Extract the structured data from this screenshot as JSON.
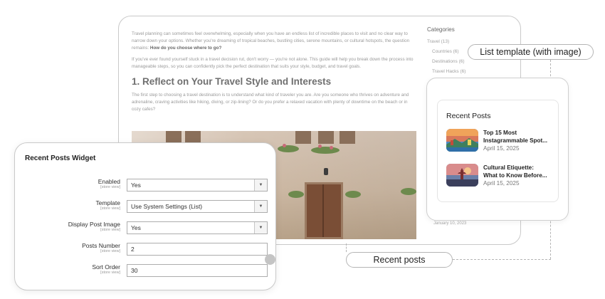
{
  "article": {
    "intro_text": "Travel planning can sometimes feel overwhelming, especially when you have an endless list of incredible places to visit and no clear way to narrow down your options. Whether you're dreaming of tropical beaches, bustling cities, serene mountains, or cultural hotspots, the question remains:",
    "intro_bold": "How do you choose where to go?",
    "para2": "If you've ever found yourself stuck in a travel decision rut, don't worry — you're not alone. This guide will help you break down the process into manageable steps, so you can confidently pick the perfect destination that suits your style, budget, and travel goals.",
    "heading": "1. Reflect on Your Travel Style and Interests",
    "para3": "The first step to choosing a travel destination is to understand what kind of traveler you are. Are you someone who thrives on adventure and adrenaline, craving activities like hiking, diving, or zip-lining? Or do you prefer a relaxed vacation with plenty of downtime on the beach or in cozy cafes?"
  },
  "sidebar": {
    "heading": "Categories",
    "items": [
      {
        "label": "Travel (13)",
        "indent": false
      },
      {
        "label": "Countries (6)",
        "indent": true
      },
      {
        "label": "Destinations (6)",
        "indent": true
      },
      {
        "label": "Travel Hacks (6)",
        "indent": true
      }
    ],
    "date": "January 10, 2023"
  },
  "labels": {
    "list_template": "List template (with image)",
    "recent_posts": "Recent posts"
  },
  "recent_posts": {
    "title": "Recent Posts",
    "items": [
      {
        "title_line1": "Top 15 Most",
        "title_line2": "Instagrammable Spot...",
        "date": "April 15, 2025"
      },
      {
        "title_line1": "Cultural Etiquette:",
        "title_line2": "What to Know Before...",
        "date": "April 15, 2025"
      }
    ]
  },
  "widget": {
    "title": "Recent Posts Widget",
    "scope_label": "[store view]",
    "fields": [
      {
        "label": "Enabled",
        "value": "Yes",
        "type": "select"
      },
      {
        "label": "Template",
        "value": "Use System Settings (List)",
        "type": "select"
      },
      {
        "label": "Display Post Image",
        "value": "Yes",
        "type": "select"
      },
      {
        "label": "Posts Number",
        "value": "2",
        "type": "input"
      },
      {
        "label": "Sort Order",
        "value": "30",
        "type": "input"
      }
    ]
  },
  "colors": {
    "border": "#c9c9c9",
    "text_dark": "#222222",
    "text_muted": "#9a9a9a"
  }
}
